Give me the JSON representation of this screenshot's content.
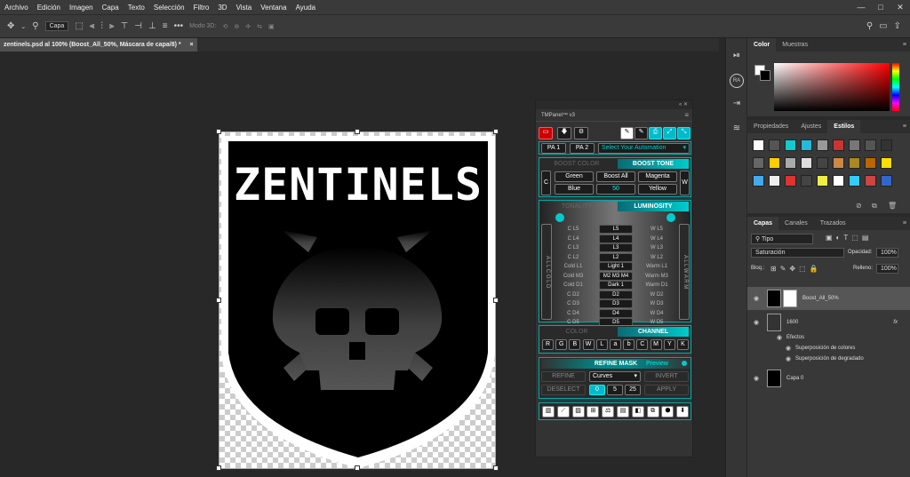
{
  "menu": [
    "Archivo",
    "Edición",
    "Imagen",
    "Capa",
    "Texto",
    "Selección",
    "Filtro",
    "3D",
    "Vista",
    "Ventana",
    "Ayuda"
  ],
  "window_controls": [
    "—",
    "□",
    "✕"
  ],
  "options": {
    "layer_select": "Capa",
    "mode3d": "Modo 3D:",
    "more": "•••"
  },
  "document_tab": {
    "title": "zentinels.psd al 100% (Boost_All_50%, Máscara de capa/8) *",
    "close": "×"
  },
  "artwork": {
    "title": "ZENTINELS"
  },
  "toolstrip": {
    "ra_label": "RA"
  },
  "color_panel": {
    "tabs": [
      "Color",
      "Muestras"
    ],
    "active": 0
  },
  "styles_panel": {
    "tabs": [
      "Propiedades",
      "Ajustes",
      "Estilos"
    ],
    "active": 2
  },
  "layers_panel": {
    "tabs": [
      "Capas",
      "Canales",
      "Trazados"
    ],
    "active": 0,
    "filter": "Tipo",
    "blend_mode": "Saturación",
    "opacity_label": "Opacidad:",
    "opacity": "100%",
    "lock_label": "Bloq.:",
    "fill_label": "Relleno:",
    "fill": "100%",
    "layers": [
      {
        "name": "Boost_All_50%",
        "selected": true
      },
      {
        "name": "1600",
        "fx": "fx"
      },
      {
        "name": "Efectos"
      },
      {
        "name": "Superposición de colores"
      },
      {
        "name": "Superposición de degradado"
      },
      {
        "name": "Capa 0"
      }
    ]
  },
  "tmpanel": {
    "title": "TMPanel™ v3",
    "pa1": "PA 1",
    "pa2": "PA 2",
    "automation": "Select Your Automation",
    "boost_color": "BOOST COLOR",
    "boost_tone": "BOOST TONE",
    "boost_left": "C",
    "boost_right": "W",
    "boost_buttons": [
      "Green",
      "Boost All",
      "Magenta",
      "Blue",
      "50",
      "Yellow"
    ],
    "tonality": "TONALITY",
    "luminosity": "LUMINOSITY",
    "all_cold": "A L L   C O L D",
    "all_warm": "A L L   W A R M",
    "lum_left": [
      "C L5",
      "C L4",
      "C L3",
      "C L2",
      "Cold L1",
      "Cold M3",
      "Cold D1",
      "C D2",
      "C D3",
      "C D4",
      "C D5"
    ],
    "lum_mid": [
      "L5",
      "L4",
      "L3",
      "L2",
      "Light 1",
      "M2 M3 M4",
      "Dark 1",
      "D2",
      "D3",
      "D4",
      "D5"
    ],
    "lum_right": [
      "W L5",
      "W L4",
      "W L3",
      "W L2",
      "Warm L1",
      "Warm M3",
      "Warm D1",
      "W D2",
      "W D3",
      "W D4",
      "W D5"
    ],
    "color": "COLOR",
    "channel": "CHANNEL",
    "channels": [
      "R",
      "G",
      "B",
      "W",
      "L",
      "a",
      "b",
      "C",
      "M",
      "Y",
      "K"
    ],
    "refine_mask": "REFINE MASK",
    "preview": "Preview",
    "refine": "REFINE",
    "curves": "Curves",
    "invert": "INVERT",
    "deselect": "DESELECT",
    "vals": [
      "0",
      "5",
      "25"
    ],
    "apply": "APPLY"
  },
  "colors": {
    "accent": "#00c8d4",
    "ps_bg": "#282828",
    "panel": "#383838"
  }
}
